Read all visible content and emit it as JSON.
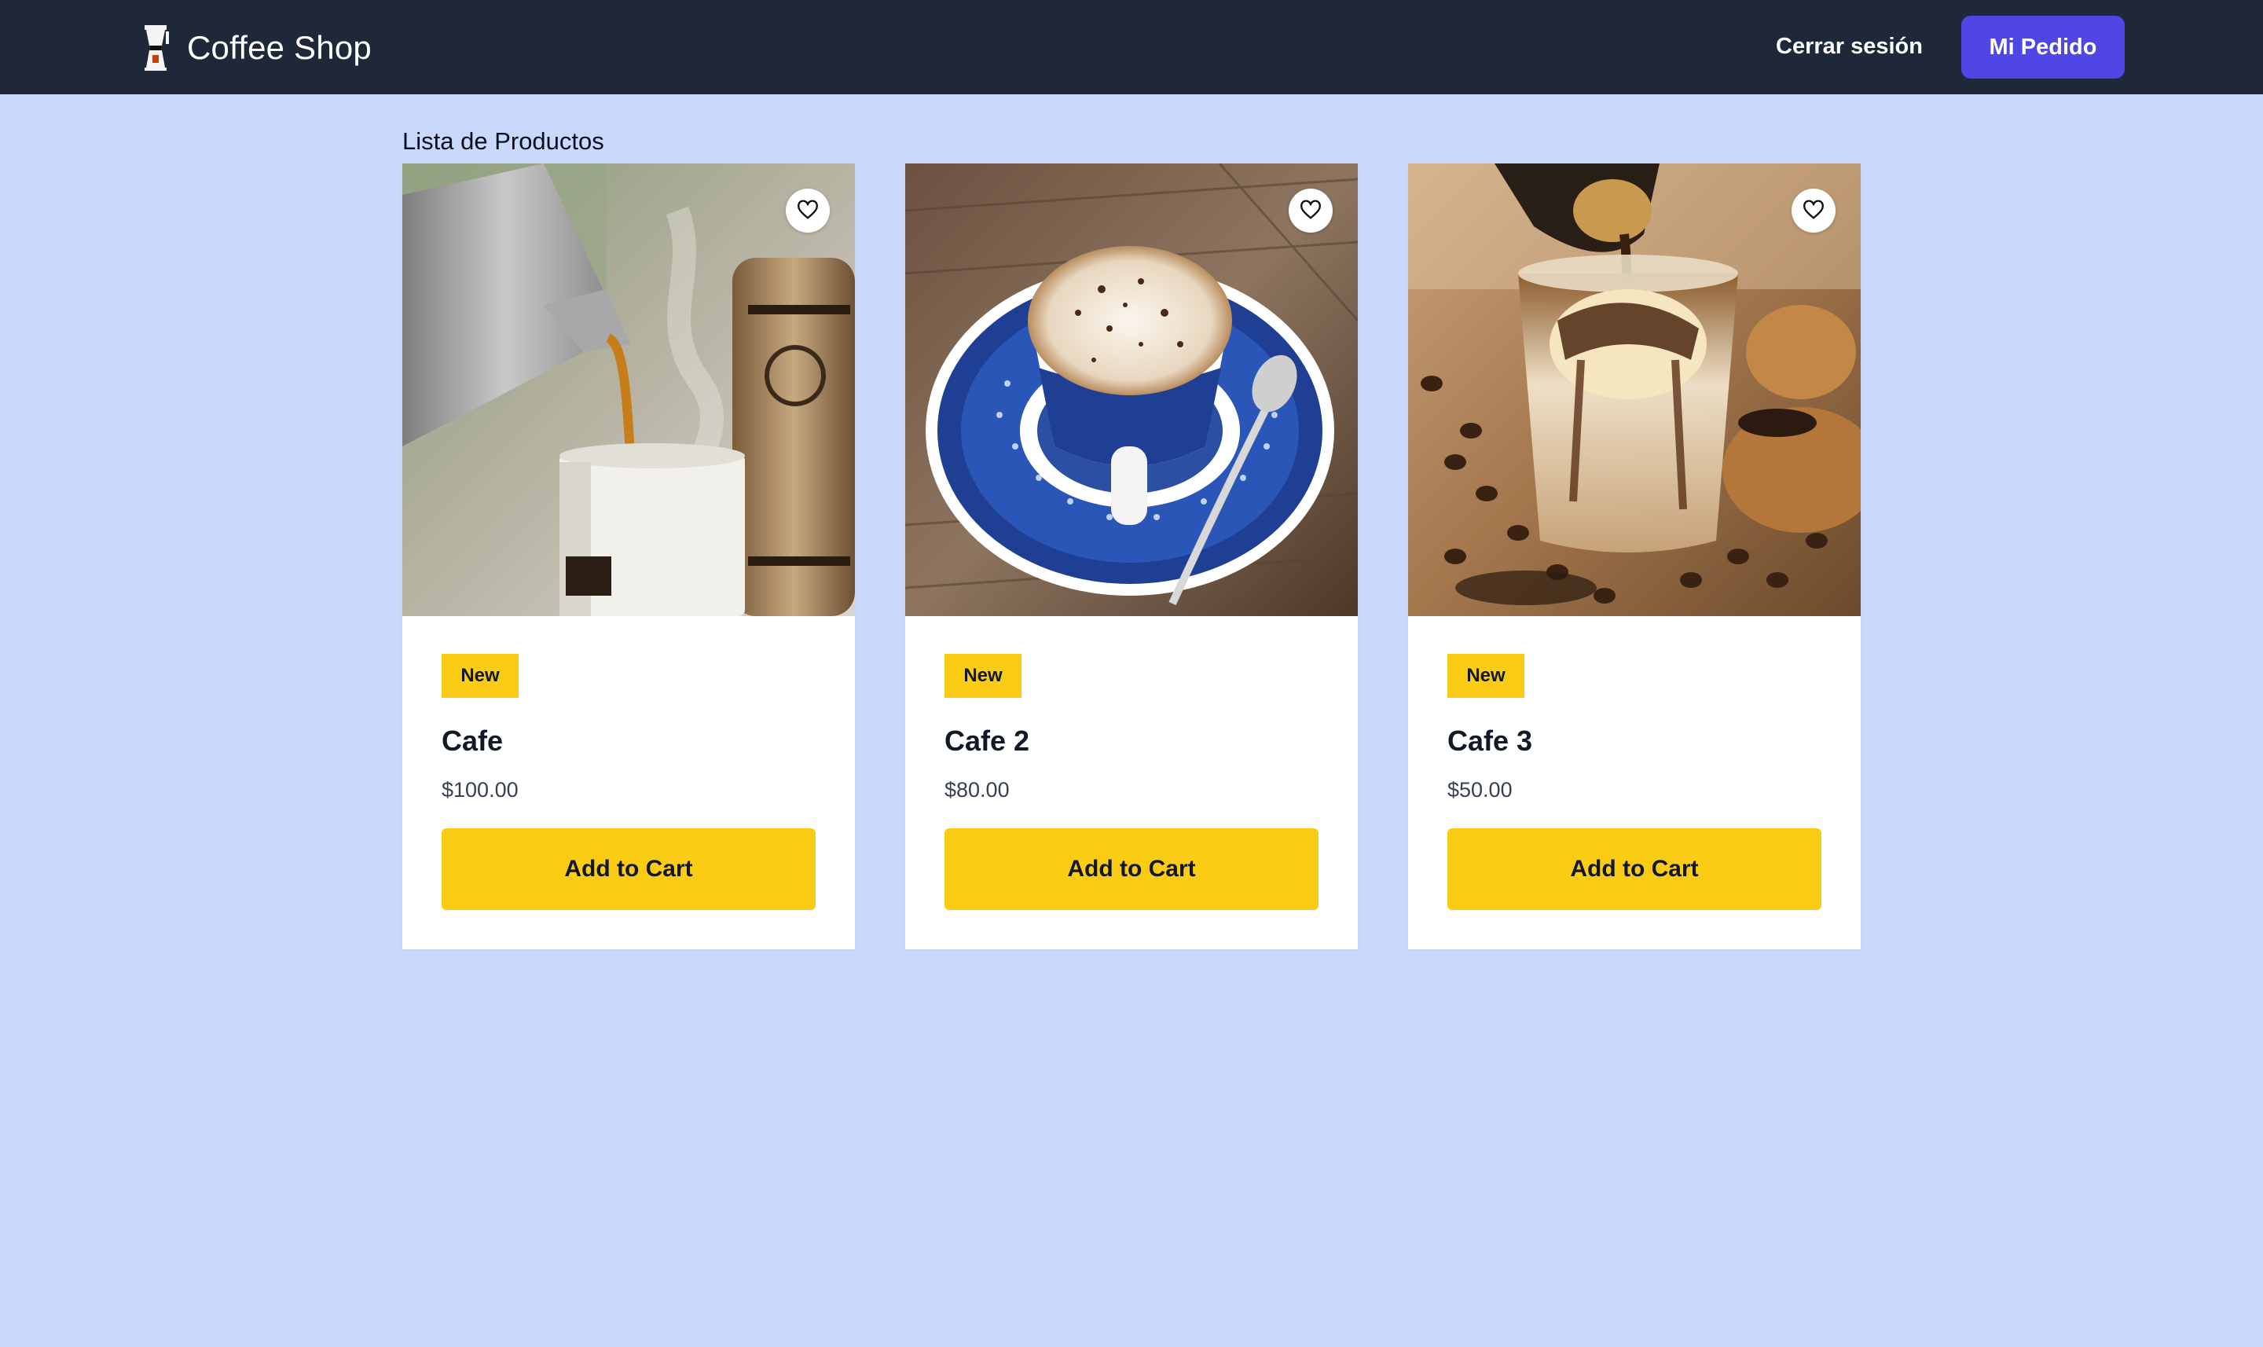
{
  "navbar": {
    "brand": "Coffee Shop",
    "brand_icon": "coffee-maker-icon",
    "logout_label": "Cerrar sesión",
    "order_label": "Mi Pedido"
  },
  "main": {
    "title": "Lista de Productos",
    "products": [
      {
        "name": "Cafe",
        "price": "$100.00",
        "badge": "New",
        "button": "Add to Cart",
        "image": "coffee-pouring-photo",
        "favorite_icon": "heart-icon"
      },
      {
        "name": "Cafe 2",
        "price": "$80.00",
        "badge": "New",
        "button": "Add to Cart",
        "image": "cappuccino-cup-photo",
        "favorite_icon": "heart-icon"
      },
      {
        "name": "Cafe 3",
        "price": "$50.00",
        "badge": "New",
        "button": "Add to Cart",
        "image": "affogato-glass-photo",
        "favorite_icon": "heart-icon"
      }
    ]
  },
  "colors": {
    "navbar_bg": "#1f2839",
    "page_bg": "#c9d8fd",
    "accent": "#4f46e5",
    "badge_and_button": "#facc15"
  }
}
